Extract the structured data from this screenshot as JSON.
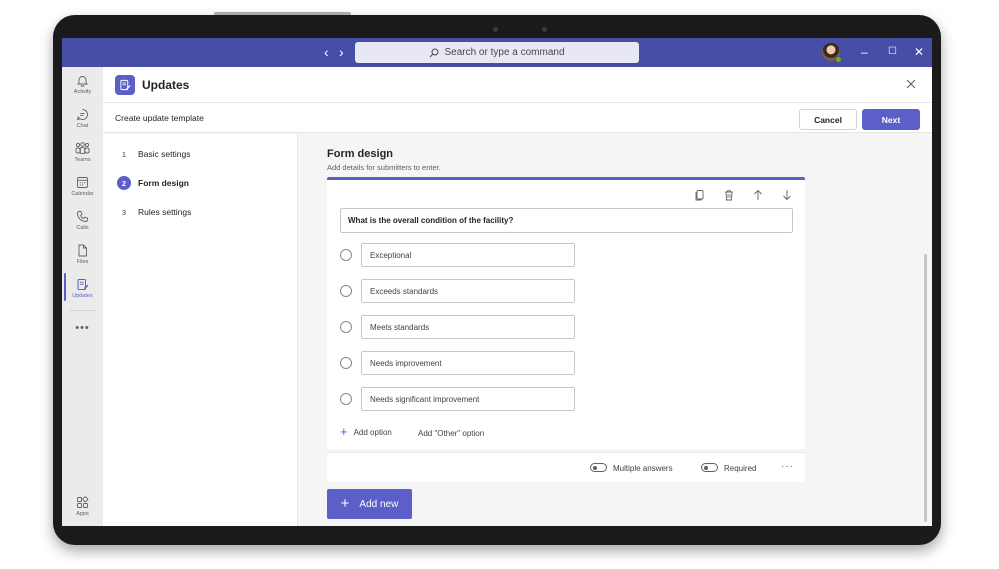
{
  "titlebar": {
    "search_placeholder": "Search or type a command"
  },
  "rail": {
    "items": [
      {
        "label": "Activity",
        "icon": "bell-icon"
      },
      {
        "label": "Chat",
        "icon": "chat-icon"
      },
      {
        "label": "Teams",
        "icon": "teams-icon"
      },
      {
        "label": "Calendar",
        "icon": "calendar-icon"
      },
      {
        "label": "Calls",
        "icon": "phone-icon"
      },
      {
        "label": "Files",
        "icon": "file-icon"
      },
      {
        "label": "Updates",
        "icon": "updates-icon",
        "active": true
      },
      {
        "label": "Apps",
        "icon": "apps-icon"
      }
    ]
  },
  "app": {
    "title": "Updates"
  },
  "subheader": {
    "title": "Create update template",
    "cancel_label": "Cancel",
    "next_label": "Next"
  },
  "steps": [
    {
      "number": "1",
      "label": "Basic settings"
    },
    {
      "number": "2",
      "label": "Form design",
      "active": true
    },
    {
      "number": "3",
      "label": "Rules settings"
    }
  ],
  "form": {
    "title": "Form design",
    "subtitle": "Add details for submitters to enter.",
    "question": "What is the overall condition of the facility?",
    "options": [
      "Exceptional",
      "Exceeds standards",
      "Meets standards",
      "Needs improvement",
      "Needs significant improvement"
    ],
    "add_option_label": "Add option",
    "add_other_label": "Add \"Other\" option",
    "multiple_answers_label": "Multiple answers",
    "required_label": "Required",
    "add_new_label": "Add new"
  },
  "colors": {
    "brand": "#5b5fc7",
    "titlebar": "#464ea6",
    "presence": "#6bb700"
  }
}
